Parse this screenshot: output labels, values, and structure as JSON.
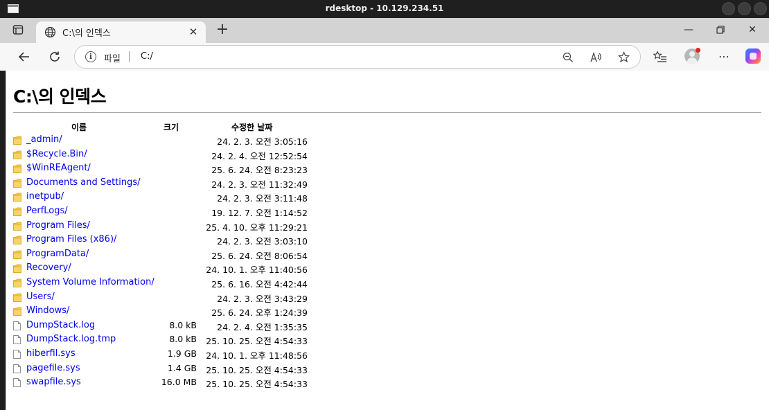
{
  "window": {
    "title": "rdesktop - 10.129.234.51"
  },
  "tab": {
    "title": "C:\\의 인덱스"
  },
  "addressbar": {
    "scheme_label": "파일",
    "url": "C:/"
  },
  "page": {
    "title": "C:\\의 인덱스"
  },
  "table": {
    "headers": {
      "name": "이름",
      "size": "크기",
      "date": "수정한 날짜"
    },
    "rows": [
      {
        "icon": "folder-icon",
        "name": "_admin/",
        "size": "",
        "date": "24. 2. 3. 오전 3:05:16"
      },
      {
        "icon": "folder-icon",
        "name": "$Recycle.Bin/",
        "size": "",
        "date": "24. 2. 4. 오전 12:52:54"
      },
      {
        "icon": "folder-icon",
        "name": "$WinREAgent/",
        "size": "",
        "date": "25. 6. 24. 오전 8:23:23"
      },
      {
        "icon": "folder-icon",
        "name": "Documents and Settings/",
        "size": "",
        "date": "24. 2. 3. 오전 11:32:49"
      },
      {
        "icon": "folder-icon",
        "name": "inetpub/",
        "size": "",
        "date": "24. 2. 3. 오전 3:11:48"
      },
      {
        "icon": "folder-icon",
        "name": "PerfLogs/",
        "size": "",
        "date": "19. 12. 7. 오전 1:14:52"
      },
      {
        "icon": "folder-icon",
        "name": "Program Files/",
        "size": "",
        "date": "25. 4. 10. 오후 11:29:21"
      },
      {
        "icon": "folder-icon",
        "name": "Program Files (x86)/",
        "size": "",
        "date": "24. 2. 3. 오전 3:03:10"
      },
      {
        "icon": "folder-icon",
        "name": "ProgramData/",
        "size": "",
        "date": "25. 6. 24. 오전 8:06:54"
      },
      {
        "icon": "folder-icon",
        "name": "Recovery/",
        "size": "",
        "date": "24. 10. 1. 오후 11:40:56"
      },
      {
        "icon": "folder-icon",
        "name": "System Volume Information/",
        "size": "",
        "date": "25. 6. 16. 오전 4:42:44"
      },
      {
        "icon": "folder-icon",
        "name": "Users/",
        "size": "",
        "date": "24. 2. 3. 오전 3:43:29"
      },
      {
        "icon": "folder-icon",
        "name": "Windows/",
        "size": "",
        "date": "25. 6. 24. 오후 1:24:39"
      },
      {
        "icon": "file-icon",
        "name": "DumpStack.log",
        "size": "8.0 kB",
        "date": "24. 2. 4. 오전 1:35:35"
      },
      {
        "icon": "file-icon",
        "name": "DumpStack.log.tmp",
        "size": "8.0 kB",
        "date": "25. 10. 25. 오전 4:54:33"
      },
      {
        "icon": "file-icon",
        "name": "hiberfil.sys",
        "size": "1.9 GB",
        "date": "24. 10. 1. 오후 11:48:56"
      },
      {
        "icon": "file-icon",
        "name": "pagefile.sys",
        "size": "1.4 GB",
        "date": "25. 10. 25. 오전 4:54:33"
      },
      {
        "icon": "file-icon",
        "name": "swapfile.sys",
        "size": "16.0 MB",
        "date": "25. 10. 25. 오전 4:54:33"
      }
    ]
  },
  "colors": {
    "link": "#0000ee",
    "folder": "#f2c94c",
    "titlebar": "#1f1f1f",
    "tabstrip": "#d3d3d3"
  }
}
